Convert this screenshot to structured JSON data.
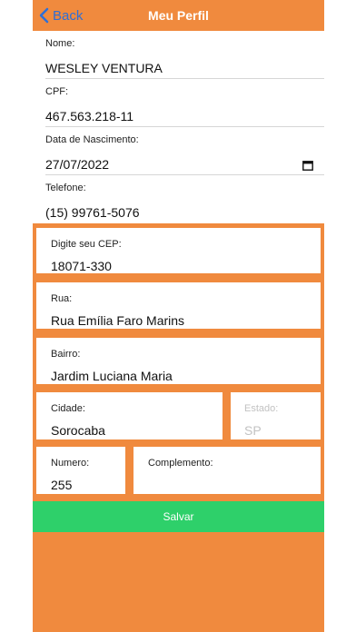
{
  "nav": {
    "back_label": "Back",
    "title": "Meu Perfil"
  },
  "fields": {
    "nome": {
      "label": "Nome:",
      "value": "WESLEY VENTURA"
    },
    "cpf": {
      "label": "CPF:",
      "value": "467.563.218-11"
    },
    "nascimento": {
      "label": "Data de Nascimento:",
      "value": "27/07/2022"
    },
    "telefone": {
      "label": "Telefone:",
      "value": "(15) 99761-5076"
    }
  },
  "address": {
    "cep": {
      "label": "Digite seu CEP:",
      "value": "18071-330"
    },
    "rua": {
      "label": "Rua:",
      "value": "Rua Emília Faro Marins"
    },
    "bairro": {
      "label": "Bairro:",
      "value": "Jardim Luciana Maria"
    },
    "cidade": {
      "label": "Cidade:",
      "value": "Sorocaba"
    },
    "estado": {
      "label": "Estado:",
      "value": "SP"
    },
    "numero": {
      "label": "Numero:",
      "value": "255"
    },
    "complemento": {
      "label": "Complemento:",
      "value": ""
    }
  },
  "actions": {
    "save_label": "Salvar"
  },
  "colors": {
    "accent": "#f08a3e",
    "save": "#2ed06a",
    "link": "#2f6fd6"
  }
}
